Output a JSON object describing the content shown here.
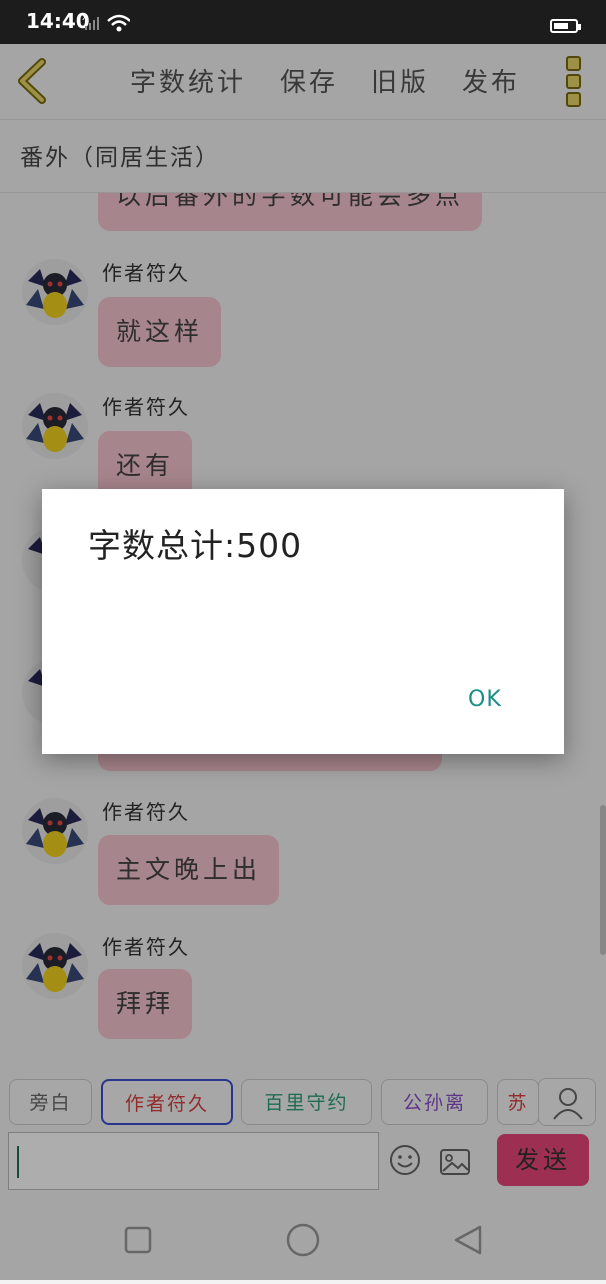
{
  "status_bar": {
    "time": "14:40"
  },
  "toolbar": {
    "word_count_label": "字数统计",
    "save_label": "保存",
    "old_version_label": "旧版",
    "publish_label": "发布"
  },
  "chapter": {
    "title": "番外（同居生活）"
  },
  "messages": [
    {
      "sender": "",
      "text": "以后番外的字数可能会多点"
    },
    {
      "sender": "作者符久",
      "text": "就这样"
    },
    {
      "sender": "作者符久",
      "text": "还有"
    },
    {
      "sender": "作者符久",
      "text": ""
    },
    {
      "sender": "作者符久",
      "text": ""
    },
    {
      "sender": "作者符久",
      "text": "主文晚上出"
    },
    {
      "sender": "作者符久",
      "text": "拜拜"
    }
  ],
  "roles": [
    {
      "label": "旁白",
      "color": "#666666"
    },
    {
      "label": "作者符久",
      "color": "#d84040",
      "selected": true
    },
    {
      "label": "百里守约",
      "color": "#2e9e7a"
    },
    {
      "label": "公孙离",
      "color": "#8a4fc8"
    },
    {
      "label": "苏",
      "color": "#d84040"
    }
  ],
  "input": {
    "value": ""
  },
  "send_label": "发送",
  "dialog": {
    "message": "字数总计:500",
    "ok_label": "OK"
  },
  "colors": {
    "bubble": "#f7c5ce",
    "send_button": "#e8467a",
    "accent": "#1a8f86"
  }
}
